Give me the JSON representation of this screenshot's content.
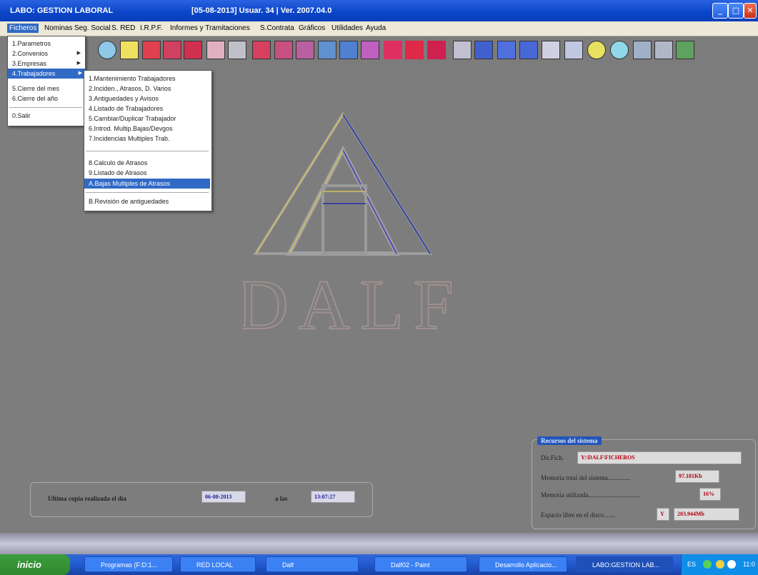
{
  "window": {
    "app_title": "LABO: GESTION LABORAL",
    "info": "[05-08-2013] Usuar. 34 | Ver. 2007.04.0",
    "minimize": "_",
    "maximize": "□",
    "close": "✕"
  },
  "menubar": [
    "Ficheros",
    "Nominas",
    "Seg. Social",
    "S. RED",
    "I.R.P.F.",
    "Informes y Tramitaciones",
    "S.Contrata",
    "Gráficos",
    "Utilidades",
    "Ayuda"
  ],
  "ficheros_menu": [
    {
      "label": "1.Parametros",
      "submenu": false
    },
    {
      "label": "2.Convenios",
      "submenu": true
    },
    {
      "label": "3.Empresas",
      "submenu": true
    },
    {
      "label": "4.Trabajadores",
      "submenu": true,
      "selected": true
    },
    {
      "label": "5.Cierre del mes",
      "submenu": false
    },
    {
      "label": "6.Cierre del año",
      "submenu": false
    },
    {
      "label": "0.Salir",
      "submenu": false
    }
  ],
  "trabajadores_menu": [
    {
      "label": "1.Mantenimiento Trabajadores"
    },
    {
      "label": "2.Inciden., Atrasos, D. Varios"
    },
    {
      "label": "3.Antiguedades y Avisos"
    },
    {
      "label": "4.Listado de Trabajadores"
    },
    {
      "label": "5.Cambiar/Duplicar Trabajador"
    },
    {
      "label": "6.Introd. Multip.Bajas/Devgos"
    },
    {
      "label": "7.Incidencias Multiples Trab."
    },
    {
      "label": "8.Calculo de Atrasos"
    },
    {
      "label": "9.Listado de Atrasos"
    },
    {
      "label": "A.Bajas Multiples de Atrasos",
      "selected": true
    },
    {
      "label": "B.Revisión de antiguedades"
    }
  ],
  "logo": {
    "text": "DALF"
  },
  "backup": {
    "label": "Ultima copia realizada el día",
    "date": "06-08-2013",
    "at_label": "a las",
    "time": "13:07:27"
  },
  "resources": {
    "title": "Recursos del sistema",
    "dir_label": "Dir.Fich.",
    "dir_value": "Y:\\DALF\\FICHEROS",
    "mem_total_label": "Memoria total del sistema..............",
    "mem_total_value": "97.181Kb",
    "mem_used_label": "Memoria utilizada................................",
    "mem_used_value": "16%",
    "disk_label": "Espacio libre en el disco.......",
    "disk_drive": "Y",
    "disk_value": "203.944Mb"
  },
  "taskbar": {
    "start": "inicio",
    "tasks": [
      "Programas (F:D:1...",
      "RED LOCAL",
      "Dalf",
      "Dalf02 - Paint",
      "Desarrollo Aplicacio...",
      "LABO:GESTION LAB..."
    ],
    "tray_lang": "ES",
    "tray_time": "11:0"
  },
  "colors": {
    "accent": "#316ac5",
    "title_bar": "#0a44c8",
    "desktop": "#7c7c7c",
    "value_red": "#b00010"
  }
}
